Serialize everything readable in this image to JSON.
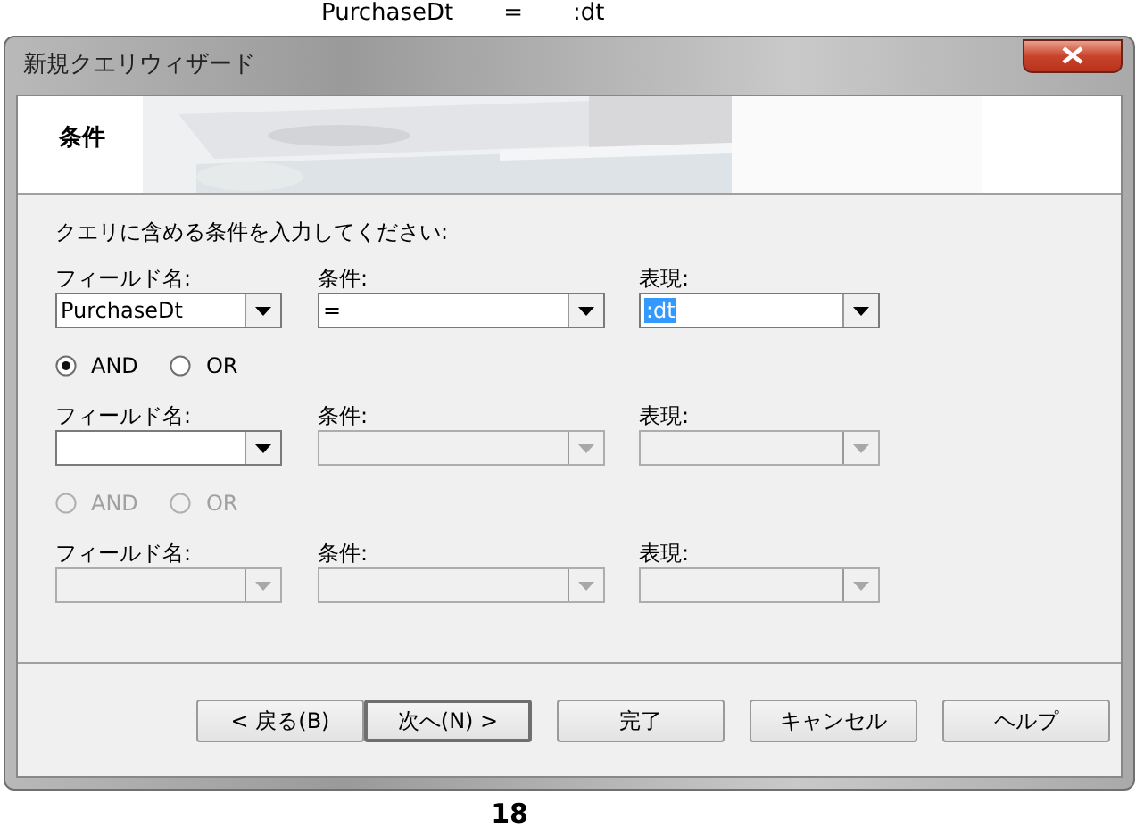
{
  "document_text_top": [
    "PurchaseDt",
    "=",
    ":dt"
  ],
  "window": {
    "title": "新規クエリウィザード"
  },
  "header": {
    "title": "条件"
  },
  "prompt": "クエリに含める条件を入力してください:",
  "rows": [
    {
      "kind": "condition",
      "field_label": "フィールド名:",
      "field": {
        "value": "PurchaseDt",
        "disabled": false
      },
      "operator_label": "条件:",
      "operator": {
        "value": "=",
        "disabled": false
      },
      "expression_label": "表現:",
      "expression": {
        "value": ":dt",
        "disabled": false,
        "highlighted": true
      }
    },
    {
      "kind": "connector",
      "disabled": false,
      "options": [
        {
          "label": "AND",
          "selected": true
        },
        {
          "label": "OR",
          "selected": false
        }
      ]
    },
    {
      "kind": "condition",
      "field_label": "フィールド名:",
      "field": {
        "disabled": false
      },
      "operator_label": "条件:",
      "operator": {
        "disabled": true
      },
      "expression_label": "表現:",
      "expression": {
        "disabled": true
      }
    },
    {
      "kind": "connector",
      "disabled": true,
      "options": [
        {
          "label": "AND",
          "selected": false
        },
        {
          "label": "OR",
          "selected": false
        }
      ]
    },
    {
      "kind": "condition",
      "field_label": "フィールド名:",
      "field": {
        "disabled": true
      },
      "operator_label": "条件:",
      "operator": {
        "disabled": true
      },
      "expression_label": "表現:",
      "expression": {
        "disabled": true
      }
    }
  ],
  "buttons": [
    {
      "label": "< 戻る(B)",
      "default": false
    },
    {
      "label": "次へ(N) >",
      "default": true
    },
    {
      "label": "完了",
      "default": false
    },
    {
      "label": "キャンセル",
      "default": false
    },
    {
      "label": "ヘルプ",
      "default": false
    }
  ],
  "caption": "18"
}
